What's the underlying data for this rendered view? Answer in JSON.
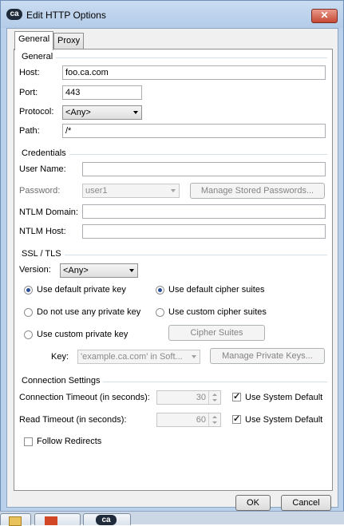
{
  "window": {
    "title": "Edit HTTP Options",
    "app_icon_text": "ca"
  },
  "tabs": [
    {
      "label": "General"
    },
    {
      "label": "Proxy"
    }
  ],
  "general": {
    "section": "General",
    "host_label": "Host:",
    "host_value": "foo.ca.com",
    "port_label": "Port:",
    "port_value": "443",
    "protocol_label": "Protocol:",
    "protocol_value": "<Any>",
    "path_label": "Path:",
    "path_value": "/*"
  },
  "credentials": {
    "section": "Credentials",
    "user_name_label": "User Name:",
    "user_name_value": "",
    "password_label": "Password:",
    "password_value": "user1",
    "manage_passwords_label": "Manage Stored Passwords...",
    "ntlm_domain_label": "NTLM Domain:",
    "ntlm_domain_value": "",
    "ntlm_host_label": "NTLM Host:",
    "ntlm_host_value": ""
  },
  "ssl": {
    "section": "SSL / TLS",
    "version_label": "Version:",
    "version_value": "<Any>",
    "use_default_key": "Use default private key",
    "no_private_key": "Do not use any private key",
    "use_custom_key": "Use custom private key",
    "use_default_cipher": "Use default cipher suites",
    "use_custom_cipher": "Use custom cipher suites",
    "cipher_suites_label": "Cipher Suites",
    "key_label": "Key:",
    "key_value": "'example.ca.com' in Soft...",
    "manage_keys_label": "Manage Private Keys..."
  },
  "connection": {
    "section": "Connection Settings",
    "conn_timeout_label": "Connection Timeout (in seconds):",
    "conn_timeout_value": "30",
    "read_timeout_label": "Read Timeout (in seconds):",
    "read_timeout_value": "60",
    "use_system_default_1": "Use System Default",
    "use_system_default_2": "Use System Default",
    "follow_redirects": "Follow Redirects"
  },
  "footer": {
    "ok_label": "OK",
    "cancel_label": "Cancel"
  },
  "taskbar": {
    "task_3_text": "ca"
  }
}
